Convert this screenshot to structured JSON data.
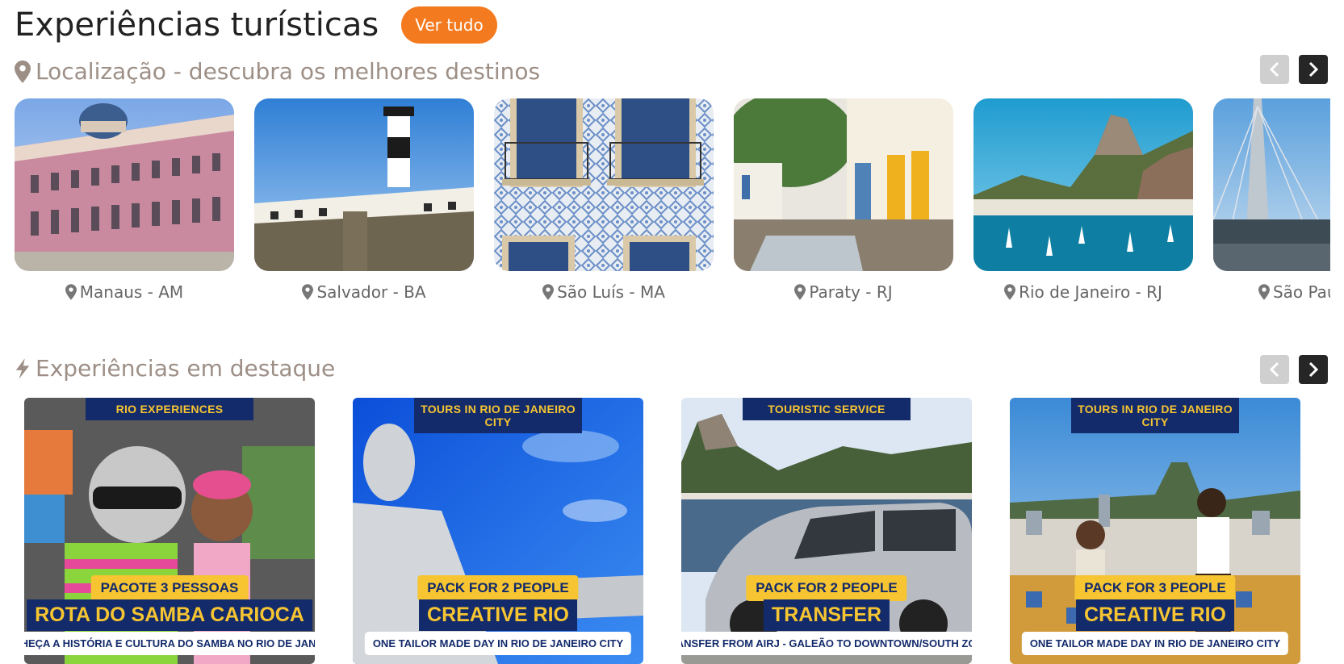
{
  "header": {
    "title": "Experiências turísticas",
    "ver_tudo": "Ver tudo"
  },
  "location_section": {
    "title": "Localização - descubra os melhores destinos",
    "icon": "map-pin-icon",
    "destinations": [
      {
        "label": "Manaus - AM"
      },
      {
        "label": "Salvador - BA"
      },
      {
        "label": "São Luís - MA"
      },
      {
        "label": "Paraty - RJ"
      },
      {
        "label": "Rio de Janeiro - RJ"
      },
      {
        "label": "São Paulo - SP"
      }
    ]
  },
  "featured_section": {
    "title": "Experiências em destaque",
    "icon": "lightning-bolt-icon",
    "experiences": [
      {
        "category": "RIO EXPERIENCES",
        "pack": "PACOTE 3 PESSOAS",
        "name": "ROTA DO SAMBA CARIOCA",
        "subtitle": "CONHEÇA A HISTÓRIA E CULTURA DO SAMBA NO RIO DE JANEIRO"
      },
      {
        "category": "TOURS IN RIO DE JANEIRO CITY",
        "pack": "PACK FOR 2 PEOPLE",
        "name": "CREATIVE RIO",
        "subtitle": "ONE TAILOR MADE DAY IN RIO DE JANEIRO CITY"
      },
      {
        "category": "TOURISTIC SERVICE",
        "pack": "PACK FOR 2 PEOPLE",
        "name": "TRANSFER",
        "subtitle": "TRANSFER FROM AIRJ - GALEÃO TO DOWNTOWN/SOUTH ZONE"
      },
      {
        "category": "TOURS IN RIO DE JANEIRO CITY",
        "pack": "PACK FOR 3 PEOPLE",
        "name": "CREATIVE RIO",
        "subtitle": "ONE TAILOR MADE DAY IN RIO DE JANEIRO CITY"
      }
    ]
  },
  "colors": {
    "accent": "#f47a1f",
    "navy": "#132a6b",
    "gold": "#f6c531",
    "muted": "#9d8f86"
  }
}
